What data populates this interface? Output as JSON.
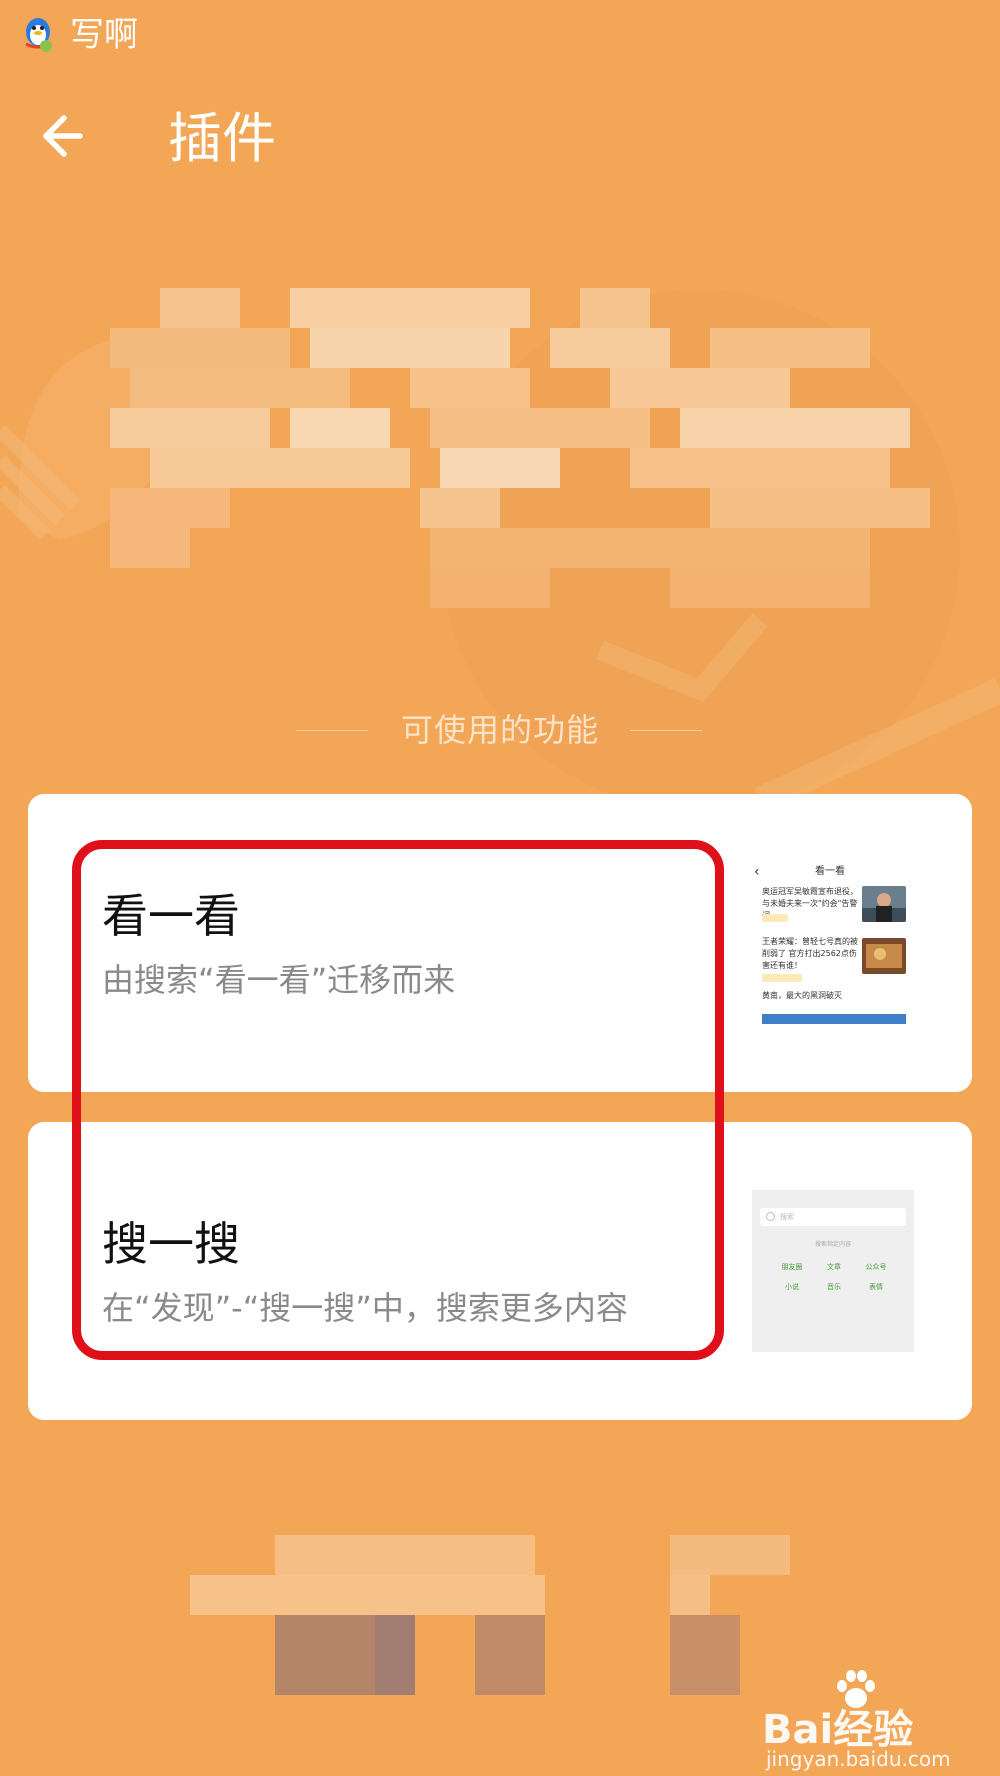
{
  "status_bar": {
    "app_name": "写啊",
    "icon": "qq-penguin-icon"
  },
  "header": {
    "back_icon": "back-arrow-icon",
    "title": "插件"
  },
  "section": {
    "label": "可使用的功能"
  },
  "plugins": [
    {
      "title": "看一看",
      "description": "由搜索“看一看”迁移而来",
      "thumbnail": {
        "title": "看一看",
        "items": [
          {
            "text": "奥运冠军吴敏霞宣布退役，与未婚夫来一次\"约会\"告警词"
          },
          {
            "text": "王者荣耀：曾轻七号真的被削弱了 官方打出2562点伤害还有谁！"
          },
          {
            "text": "黄南，最大的黑洞破灭"
          }
        ]
      }
    },
    {
      "title": "搜一搜",
      "description": "在“发现”-“搜一搜”中，搜索更多内容",
      "thumbnail": {
        "search_placeholder": "搜索",
        "hint": "搜索指定内容",
        "links": [
          "朋友圈",
          "文章",
          "公众号",
          "小说",
          "音乐",
          "表情"
        ]
      }
    }
  ],
  "watermark": {
    "brand": "Bai经验",
    "url": "jingyan.baidu.com"
  },
  "colors": {
    "background": "#F2A656",
    "highlight": "#E0101A",
    "card": "#FFFFFF"
  }
}
